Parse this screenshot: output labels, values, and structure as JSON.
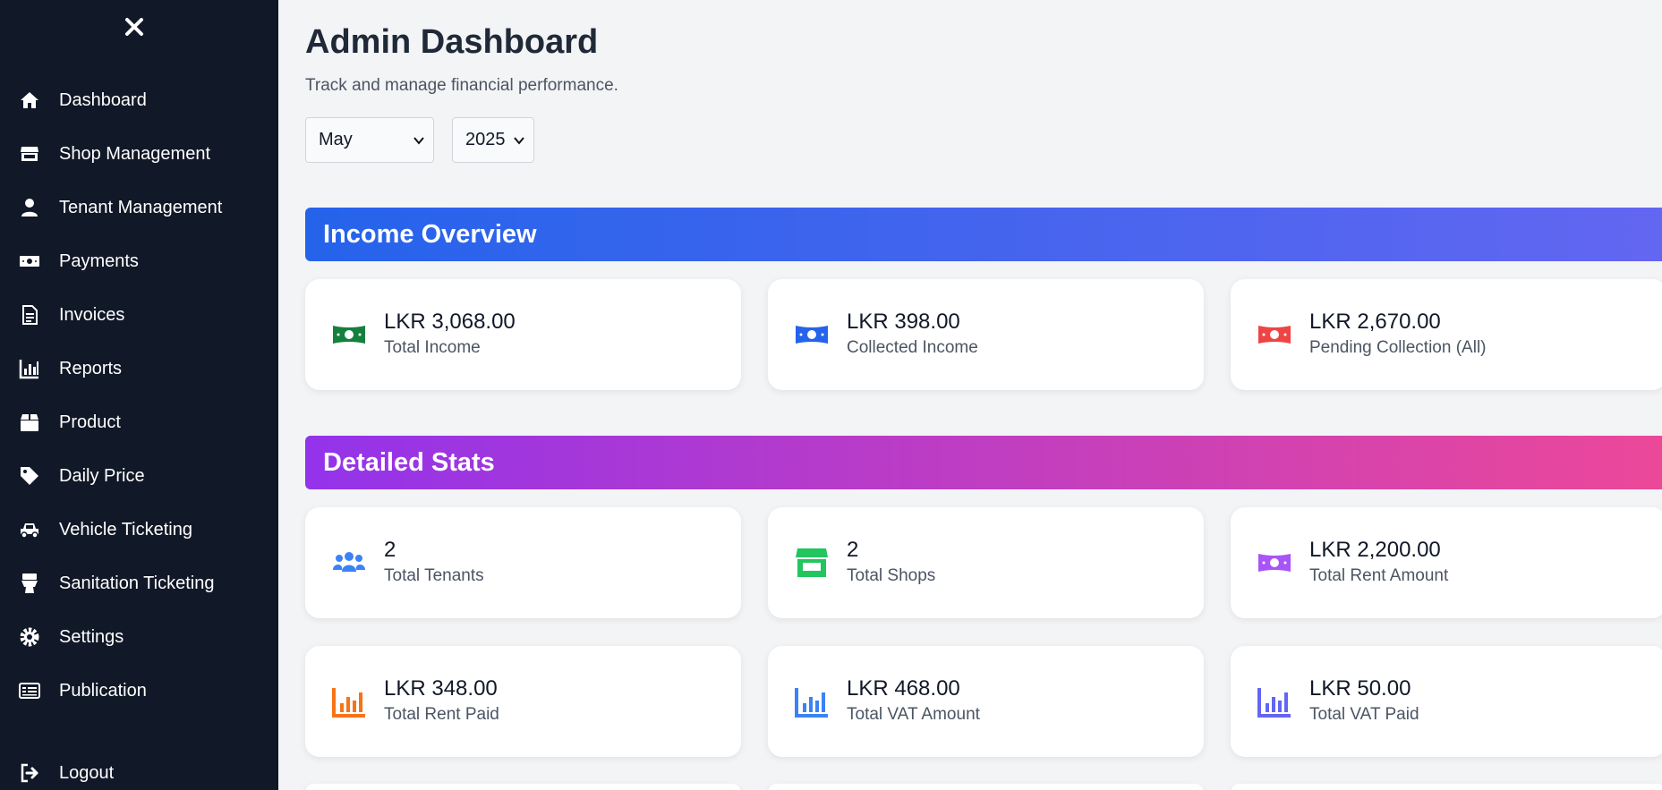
{
  "sidebar": {
    "items": [
      {
        "label": "Dashboard",
        "icon": "home-icon"
      },
      {
        "label": "Shop Management",
        "icon": "store-icon"
      },
      {
        "label": "Tenant Management",
        "icon": "user-icon"
      },
      {
        "label": "Payments",
        "icon": "money-bill-icon"
      },
      {
        "label": "Invoices",
        "icon": "invoice-icon"
      },
      {
        "label": "Reports",
        "icon": "chart-bar-icon"
      },
      {
        "label": "Product",
        "icon": "box-icon"
      },
      {
        "label": "Daily Price",
        "icon": "tag-icon"
      },
      {
        "label": "Vehicle Ticketing",
        "icon": "car-icon"
      },
      {
        "label": "Sanitation Ticketing",
        "icon": "toilet-icon"
      },
      {
        "label": "Settings",
        "icon": "gear-icon"
      },
      {
        "label": "Publication",
        "icon": "newspaper-icon"
      }
    ],
    "logout": {
      "label": "Logout",
      "icon": "logout-icon"
    }
  },
  "header": {
    "title": "Admin Dashboard",
    "subtitle": "Track and manage financial performance."
  },
  "filters": {
    "month": "May",
    "year": "2025"
  },
  "income_overview": {
    "title": "Income Overview",
    "cards": [
      {
        "value": "LKR 3,068.00",
        "label": "Total Income",
        "color": "#15803d"
      },
      {
        "value": "LKR 398.00",
        "label": "Collected Income",
        "color": "#2563eb"
      },
      {
        "value": "LKR 2,670.00",
        "label": "Pending Collection (All)",
        "color": "#ef4444"
      }
    ]
  },
  "detailed_stats": {
    "title": "Detailed Stats",
    "cards": [
      {
        "value": "2",
        "label": "Total Tenants",
        "color": "#3b82f6"
      },
      {
        "value": "2",
        "label": "Total Shops",
        "color": "#22c55e"
      },
      {
        "value": "LKR 2,200.00",
        "label": "Total Rent Amount",
        "color": "#a855f7"
      },
      {
        "value": "LKR 348.00",
        "label": "Total Rent Paid",
        "color": "#f97316"
      },
      {
        "value": "LKR 468.00",
        "label": "Total VAT Amount",
        "color": "#3b82f6"
      },
      {
        "value": "LKR 50.00",
        "label": "Total VAT Paid",
        "color": "#6366f1"
      }
    ]
  },
  "colors": {
    "sidebar_bg": "#111827",
    "page_bg": "#f3f4f6",
    "income_banner": [
      "#2563eb",
      "#6366f1"
    ],
    "stats_banner": [
      "#9333ea",
      "#ec4899"
    ]
  }
}
